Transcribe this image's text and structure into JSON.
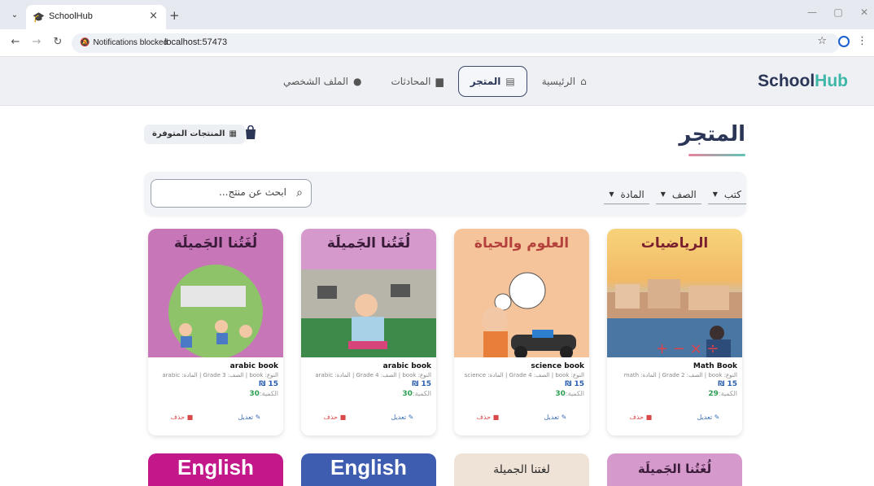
{
  "browser": {
    "tab_title": "SchoolHub",
    "notification_chip": "Notifications blocked",
    "url": "localhost:57473"
  },
  "header": {
    "logo_part1": "School",
    "logo_part2": "Hub",
    "nav": [
      {
        "label": "الرئيسية",
        "icon": "home-icon"
      },
      {
        "label": "المتجر",
        "icon": "store-icon",
        "active": true
      },
      {
        "label": "المحادثات",
        "icon": "chat-icon"
      },
      {
        "label": "الملف الشخصي",
        "icon": "person-icon"
      }
    ]
  },
  "page": {
    "title": "المتجر",
    "available_button": "المنتجات المتوفرة",
    "search_placeholder": "ابحث عن منتج...",
    "filters": [
      "كتب",
      "الصف",
      "المادة"
    ]
  },
  "colors": {
    "brand_dark": "#2b3556",
    "brand_accent": "#3fb7a8",
    "price": "#2b5fb0",
    "qty": "#2e9e52",
    "delete": "#d84a4a",
    "edit": "#3a6fb8"
  },
  "products": [
    {
      "cover_title": "الرياضيات",
      "name": "Math Book",
      "meta": "النوع: book | الصف: Grade 2 | المادة: math",
      "price": "15 ₪",
      "qty_label": "الكمية:",
      "qty": "29",
      "edit": "تعديل",
      "delete": "حذف"
    },
    {
      "cover_title": "العلوم والحياة",
      "name": "science book",
      "meta": "النوع: book | الصف: Grade 4 | المادة: science",
      "price": "15 ₪",
      "qty_label": "الكمية:",
      "qty": "30",
      "edit": "تعديل",
      "delete": "حذف"
    },
    {
      "cover_title": "لُغَتُنا الجَميلَة",
      "name": "arabic book",
      "meta": "النوع: book | الصف: Grade 4 | المادة: arabic",
      "price": "15 ₪",
      "qty_label": "الكمية:",
      "qty": "30",
      "edit": "تعديل",
      "delete": "حذف"
    },
    {
      "cover_title": "لُغَتُنا الجَميلَة",
      "name": "arabic book",
      "meta": "النوع: book | الصف: Grade 3 | المادة: arabic",
      "price": "15 ₪",
      "qty_label": "الكمية:",
      "qty": "30",
      "edit": "تعديل",
      "delete": "حذف"
    }
  ],
  "products_row2": [
    {
      "cover_title": "لُغَتُنا الجَميلَة"
    },
    {
      "cover_title": "لغتنا الجميلة"
    },
    {
      "cover_title": "English"
    },
    {
      "cover_title": "English"
    }
  ]
}
